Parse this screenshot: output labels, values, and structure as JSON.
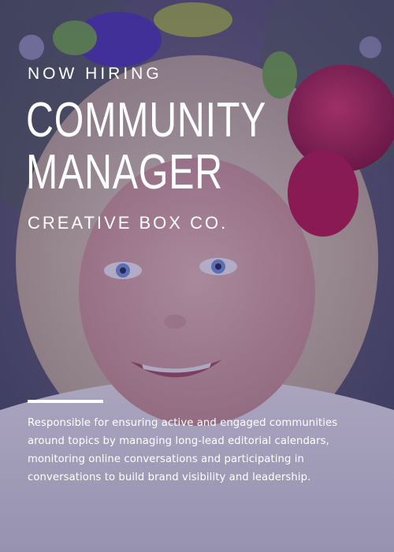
{
  "poster": {
    "eyebrow": "NOW HIRING",
    "title_line_1": "COMMUNITY",
    "title_line_2": "MANAGER",
    "company": "CREATIVE BOX CO.",
    "description": "Responsible for ensuring active and engaged communities around topics by managing long-lead editorial calendars, monitoring online conversations and participating in conversations to build brand visibility and leadership."
  },
  "colors": {
    "overlay": "#373078",
    "text": "#ffffff",
    "flower_rose": "#c8103f",
    "flower_purple": "#4a2fb0",
    "foliage": "#6fa83a"
  }
}
